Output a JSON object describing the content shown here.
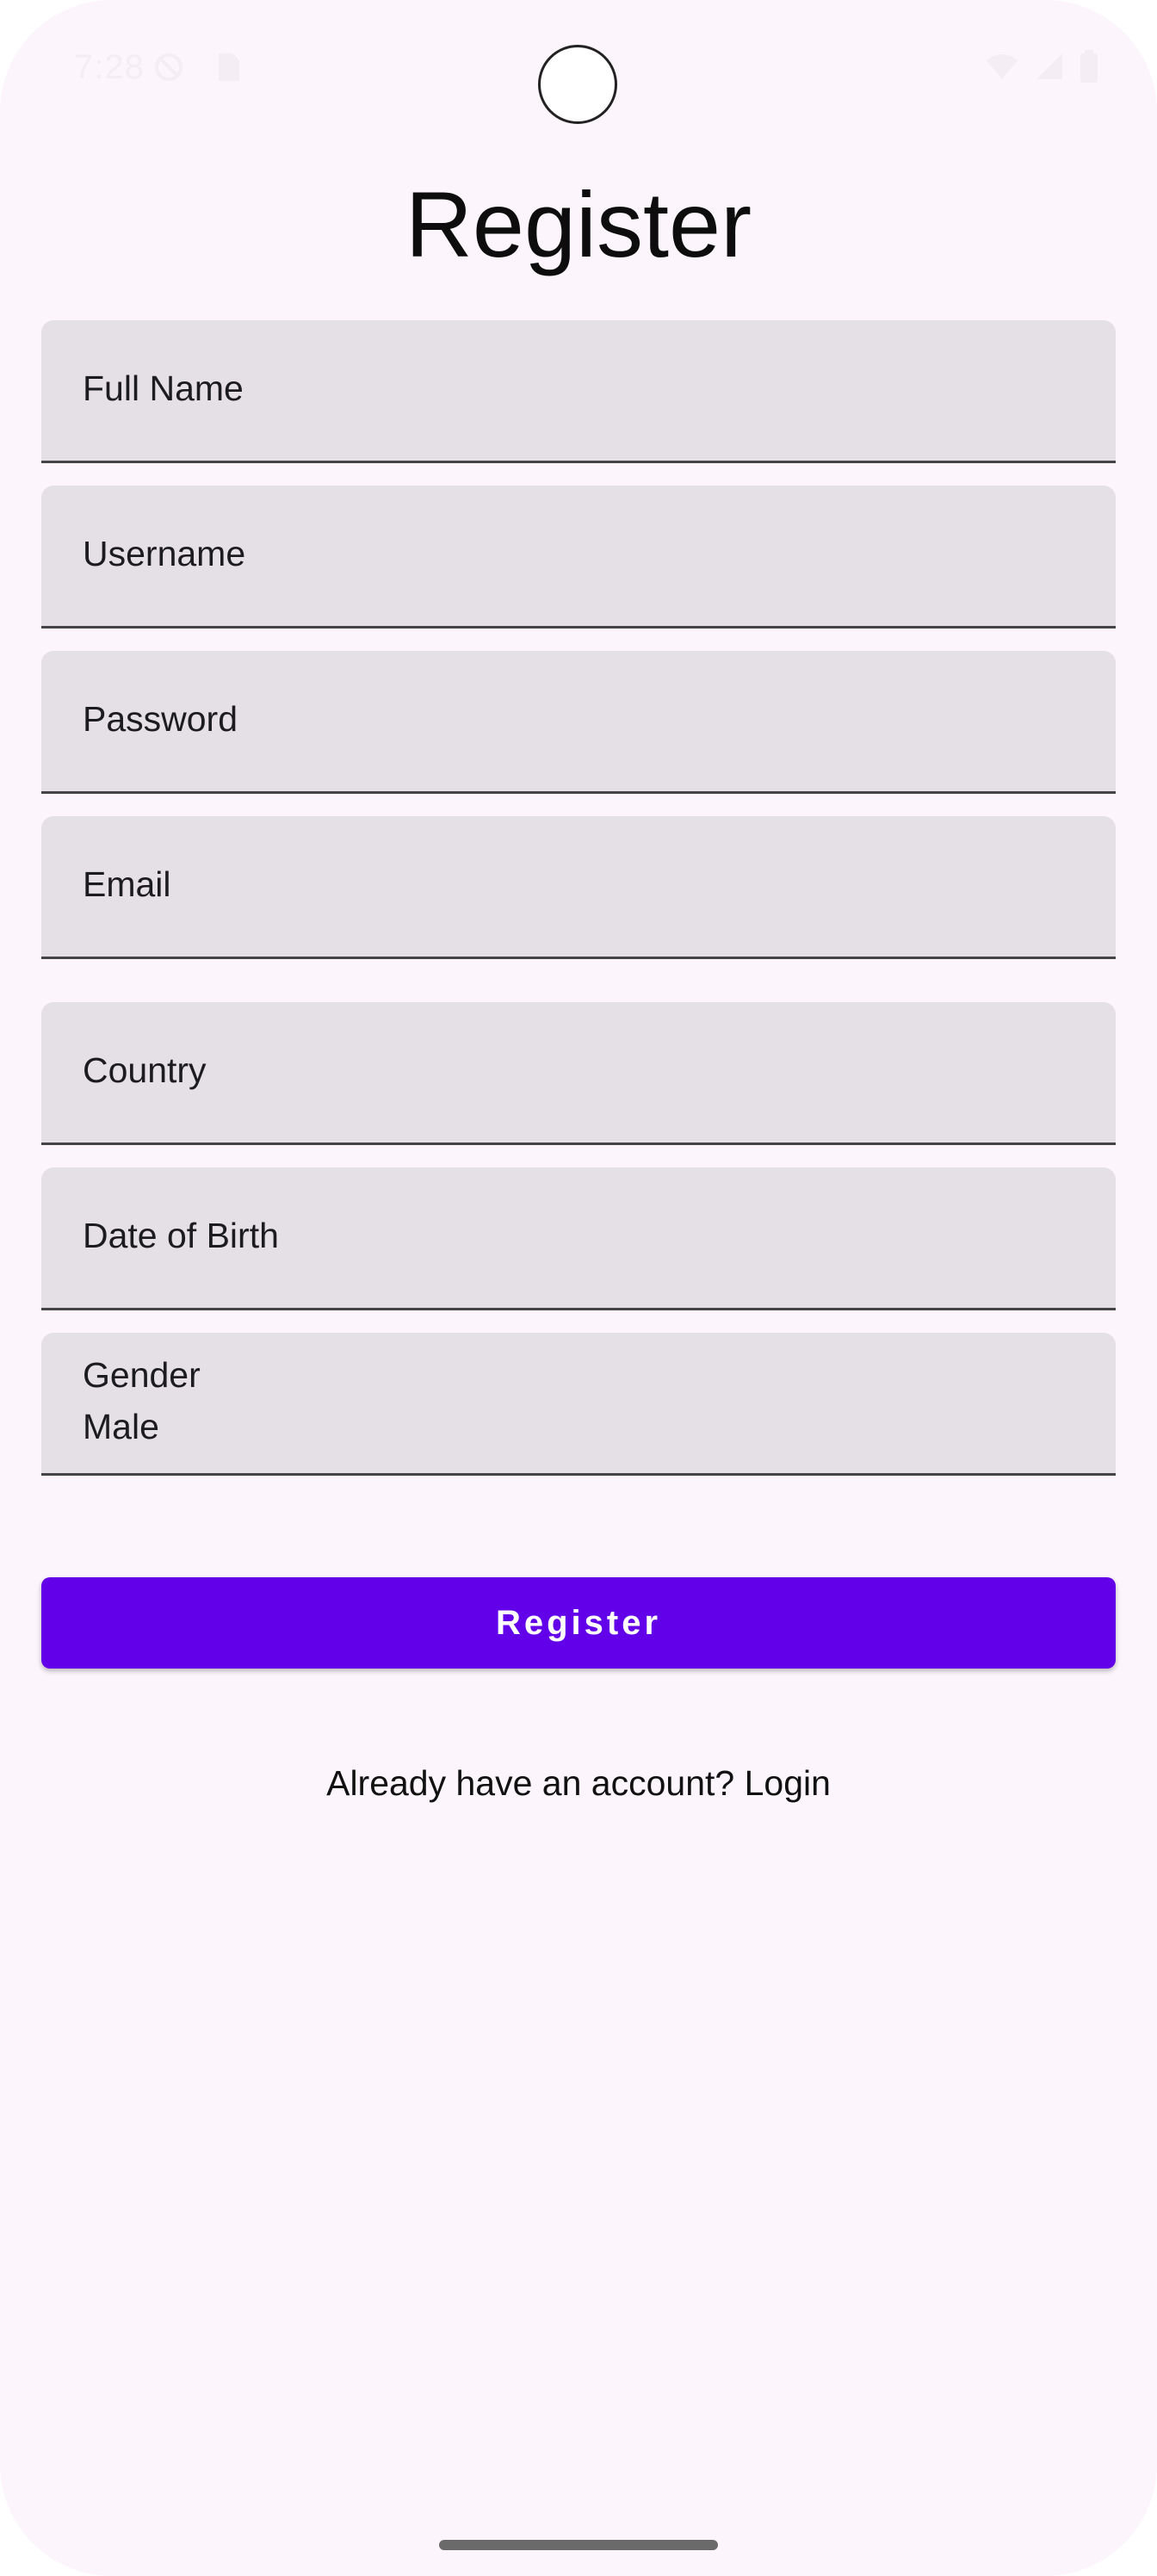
{
  "status_bar": {
    "time": "7:28",
    "icons_left": [
      "do-not-disturb-icon",
      "sd-card-icon"
    ],
    "icons_right": [
      "wifi-icon",
      "signal-icon",
      "battery-icon"
    ]
  },
  "page": {
    "title": "Register"
  },
  "form": {
    "full_name": {
      "label": "Full Name"
    },
    "username": {
      "label": "Username"
    },
    "password": {
      "label": "Password"
    },
    "email": {
      "label": "Email"
    },
    "country": {
      "label": "Country"
    },
    "date_of_birth": {
      "label": "Date of Birth"
    },
    "gender": {
      "label": "Gender",
      "value": "Male"
    }
  },
  "actions": {
    "register_label": "Register",
    "login_prompt": "Already have an account? Login"
  },
  "colors": {
    "background": "#FCF5FC",
    "field_bg": "#E5E0E6",
    "primary": "#6200EA"
  }
}
